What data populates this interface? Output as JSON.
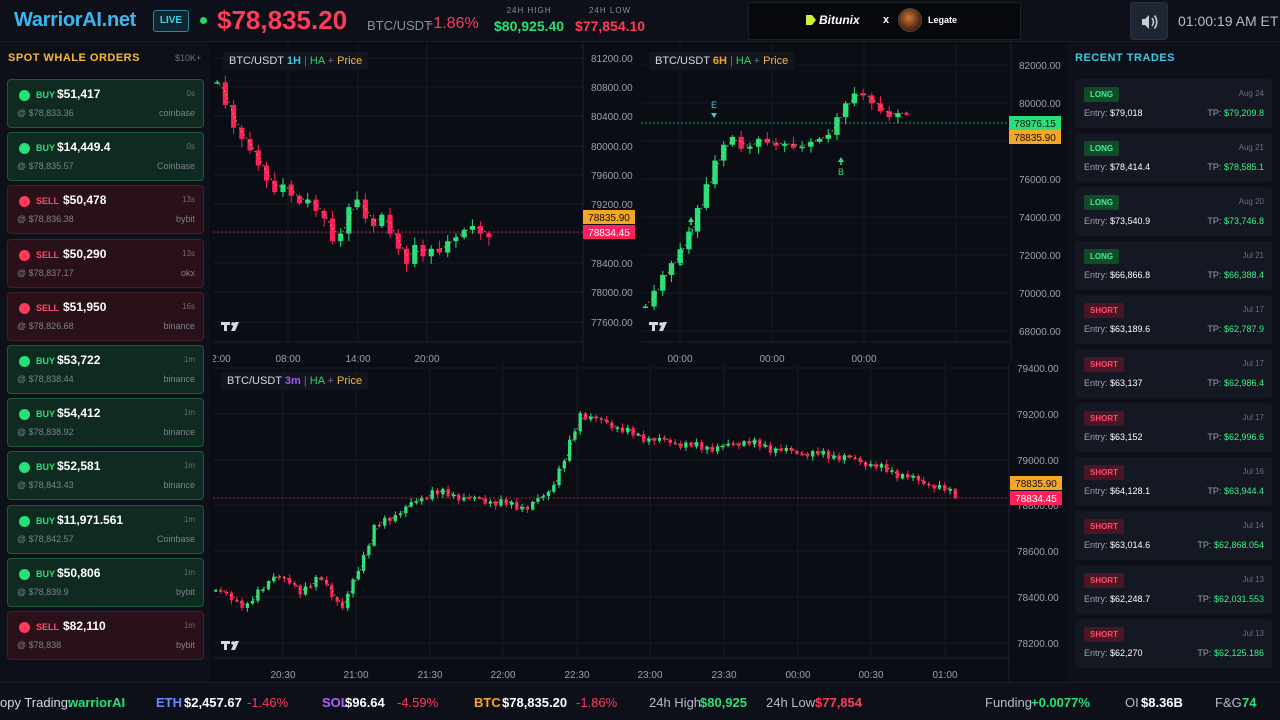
{
  "header": {
    "brand": "WarriorAI.net",
    "live_label": "LIVE",
    "price": "$78,835.20",
    "pair": "BTC/USDT",
    "change": "-1.86%",
    "high_caption": "24H HIGH",
    "high_value": "$80,925.40",
    "low_caption": "24H LOW",
    "low_value": "$77,854.10",
    "sponsor_brand": "Bitunix",
    "sponsor_x": "x",
    "sponsor_partner": "Legate",
    "clock": "01:00:19 AM ET"
  },
  "whale": {
    "title": "SPOT WHALE ORDERS",
    "threshold": "$10K+",
    "orders": [
      {
        "side": "BUY",
        "amount": "$51,417",
        "age": "0s",
        "at": "@ $78,833.36",
        "exchange": "coinbase"
      },
      {
        "side": "BUY",
        "amount": "$14,449.4",
        "age": "0s",
        "at": "@ $78,835.57",
        "exchange": "Coinbase"
      },
      {
        "side": "SELL",
        "amount": "$50,478",
        "age": "13s",
        "at": "@ $78,836.38",
        "exchange": "bybit"
      },
      {
        "side": "SELL",
        "amount": "$50,290",
        "age": "13s",
        "at": "@ $78,837.17",
        "exchange": "okx"
      },
      {
        "side": "SELL",
        "amount": "$51,950",
        "age": "16s",
        "at": "@ $78,826.68",
        "exchange": "binance"
      },
      {
        "side": "BUY",
        "amount": "$53,722",
        "age": "1m",
        "at": "@ $78,838.44",
        "exchange": "binance"
      },
      {
        "side": "BUY",
        "amount": "$54,412",
        "age": "1m",
        "at": "@ $78,838.92",
        "exchange": "binance"
      },
      {
        "side": "BUY",
        "amount": "$52,581",
        "age": "1m",
        "at": "@ $78,843.43",
        "exchange": "binance"
      },
      {
        "side": "BUY",
        "amount": "$11,971.561",
        "age": "1m",
        "at": "@ $78,842.57",
        "exchange": "Coinbase"
      },
      {
        "side": "BUY",
        "amount": "$50,806",
        "age": "1m",
        "at": "@ $78,839.9",
        "exchange": "bybit"
      },
      {
        "side": "SELL",
        "amount": "$82,110",
        "age": "1m",
        "at": "@ $78,838",
        "exchange": "bybit"
      }
    ]
  },
  "charts": {
    "c1": {
      "symbol": "BTC/USDT",
      "tf": "1H",
      "ha": "HA",
      "plus": "+",
      "price": "Price",
      "y_ticks": [
        "81200.00",
        "80800.00",
        "80400.00",
        "80000.00",
        "79600.00",
        "79200.00",
        "78400.00",
        "78000.00",
        "77600.00"
      ],
      "x_ticks": [
        "2:00",
        "08:00",
        "14:00",
        "20:00"
      ],
      "price_tag": "78835.90",
      "last_tag": "78834.45"
    },
    "c2": {
      "symbol": "BTC/USDT",
      "tf": "6H",
      "ha": "HA",
      "plus": "+",
      "price": "Price",
      "y_ticks": [
        "82000.00",
        "80000.00",
        "76000.00",
        "74000.00",
        "72000.00",
        "70000.00",
        "68000.00"
      ],
      "x_ticks": [
        "00:00",
        "00:00",
        "00:00"
      ],
      "tag_a": "78976.15",
      "tag_b": "78835.90",
      "markers": [
        "E",
        "B",
        "B",
        "B"
      ]
    },
    "c3": {
      "symbol": "BTC/USDT",
      "tf": "3m",
      "ha": "HA",
      "plus": "+",
      "price": "Price",
      "y_ticks": [
        "79400.00",
        "79200.00",
        "79000.00",
        "78800.00",
        "78600.00",
        "78400.00",
        "78200.00"
      ],
      "x_ticks": [
        "20:30",
        "21:00",
        "21:30",
        "22:00",
        "22:30",
        "23:00",
        "23:30",
        "00:00",
        "00:30",
        "01:00"
      ],
      "price_tag": "78835.90",
      "last_tag": "78834.45"
    }
  },
  "trades": {
    "title": "RECENT TRADES",
    "items": [
      {
        "side": "LONG",
        "date": "Aug 24",
        "entry": "$79,018",
        "tp": "$79,209.8"
      },
      {
        "side": "LONG",
        "date": "Aug 21",
        "entry": "$78,414.4",
        "tp": "$78,585.1"
      },
      {
        "side": "LONG",
        "date": "Aug 20",
        "entry": "$73,540.9",
        "tp": "$73,746.8"
      },
      {
        "side": "LONG",
        "date": "Jul 21",
        "entry": "$66,866.8",
        "tp": "$66,388.4"
      },
      {
        "side": "SHORT",
        "date": "Jul 17",
        "entry": "$63,189.6",
        "tp": "$62,787.9"
      },
      {
        "side": "SHORT",
        "date": "Jul 17",
        "entry": "$63,137",
        "tp": "$62,986.4"
      },
      {
        "side": "SHORT",
        "date": "Jul 17",
        "entry": "$63,152",
        "tp": "$62,996.6"
      },
      {
        "side": "SHORT",
        "date": "Jul 16",
        "entry": "$64,128.1",
        "tp": "$63,944.4"
      },
      {
        "side": "SHORT",
        "date": "Jul 14",
        "entry": "$63,014.6",
        "tp": "$62,868.054"
      },
      {
        "side": "SHORT",
        "date": "Jul 13",
        "entry": "$62,248.7",
        "tp": "$62,031.553"
      },
      {
        "side": "SHORT",
        "date": "Jul 13",
        "entry": "$62,270",
        "tp": "$62,125.186"
      }
    ],
    "entry_label": "Entry:",
    "tp_label": "TP:"
  },
  "ticker": {
    "copy_label": "opy Trading:",
    "copy_name": "warriorAI",
    "eth_sym": "ETH",
    "eth_price": "$2,457.67",
    "eth_chg": "-1.46%",
    "sol_sym": "SOL",
    "sol_price": "$96.64",
    "sol_chg": "-4.59%",
    "btc_sym": "BTC",
    "btc_price": "$78,835.20",
    "btc_chg": "-1.86%",
    "high_label": "24h High",
    "high_val": "$80,925",
    "low_label": "24h Low",
    "low_val": "$77,854",
    "funding_label": "Funding",
    "funding_val": "+0.0077%",
    "oi_label": "OI",
    "oi_val": "$8.36B",
    "fg_label": "F&G",
    "fg_val": "74"
  },
  "colors": {
    "up": "#26e07a",
    "down": "#ff1f5a",
    "accent": "#3ab7f0",
    "gold": "#f5b93a"
  }
}
